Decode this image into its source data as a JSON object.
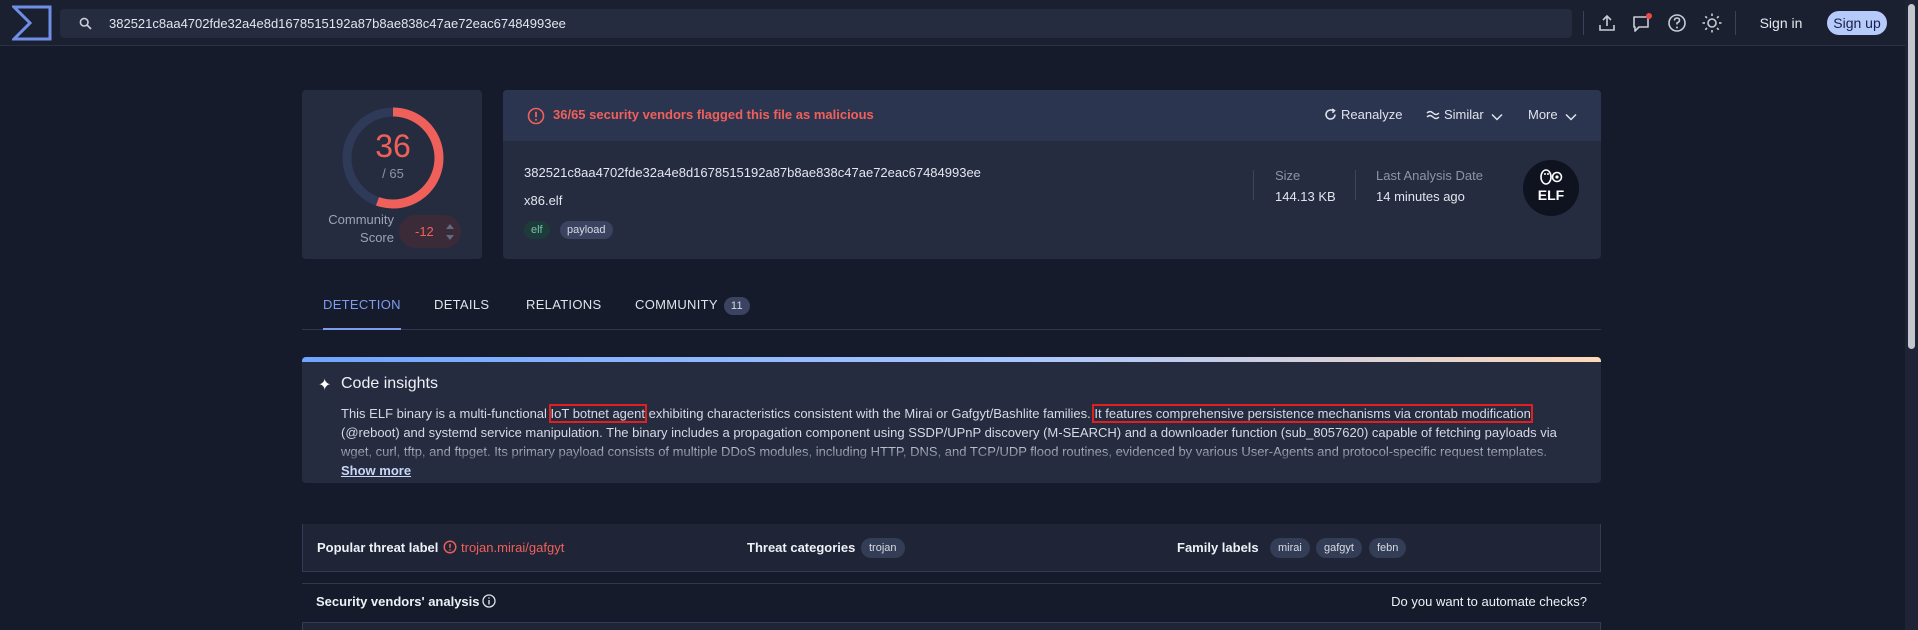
{
  "search": {
    "value": "382521c8aa4702fde32a4e8d1678515192a87b8ae838c47ae72eac67484993ee"
  },
  "header": {
    "signin_label": "Sign in",
    "signup_label": "Sign up"
  },
  "score": {
    "detections": "36",
    "total": "/ 65",
    "fraction": 0.5538,
    "community_label": "Community Score",
    "community_value": "-12"
  },
  "file": {
    "alert_text": "36/65 security vendors flagged this file as malicious",
    "actions": {
      "reanalyze": "Reanalyze",
      "similar": "Similar",
      "more": "More"
    },
    "hash": "382521c8aa4702fde32a4e8d1678515192a87b8ae838c47ae72eac67484993ee",
    "name": "x86.elf",
    "tags": [
      "elf",
      "payload"
    ],
    "size_label": "Size",
    "size_value": "144.13 KB",
    "last_analysis_label": "Last Analysis Date",
    "last_analysis_value": "14 minutes ago",
    "type_badge": "ELF"
  },
  "tabs": [
    {
      "label": "DETECTION",
      "active": true
    },
    {
      "label": "DETAILS"
    },
    {
      "label": "RELATIONS"
    },
    {
      "label": "COMMUNITY",
      "count": "11"
    }
  ],
  "insights": {
    "title": "Code insights",
    "text_pre": "This ELF binary is a multi-functional ",
    "text_hl1": "IoT botnet agent",
    "text_mid": " exhibiting characteristics consistent with the Mirai or Gafgyt/Bashlite families. ",
    "text_hl2": "It features comprehensive persistence mechanisms via crontab modification",
    "text_post": " (@reboot) and systemd service manipulation. The binary includes a propagation component using SSDP/UPnP discovery (M-SEARCH) and a downloader function (sub_8057620) capable of fetching payloads via wget, curl, tftp, and ftpget. Its primary payload consists of multiple DDoS modules, including HTTP, DNS, and TCP/UDP flood routines, evidenced by various User-Agents and protocol-specific request templates. Furthermore, it contains process-killing logic that scans /proc to terminate competing malware. Notable IOCs include the strings '/tmp/botnet', persistence scripts in '/tmp/rc.local.tmp' and '/tmp/.crontmp', and",
    "show_more": "Show more"
  },
  "labels": {
    "popular_title": "Popular threat label",
    "popular_value": "trojan.mirai/gafgyt",
    "categories_title": "Threat categories",
    "categories": [
      "trojan"
    ],
    "family_title": "Family labels",
    "families": [
      "mirai",
      "gafgyt",
      "febn"
    ]
  },
  "vendors": {
    "title": "Security vendors' analysis",
    "automate": "Do you want to automate checks?"
  },
  "colors": {
    "accent": "#7e9cf0",
    "malicious": "#f0605a",
    "highlight_box": "#e21f1f"
  }
}
